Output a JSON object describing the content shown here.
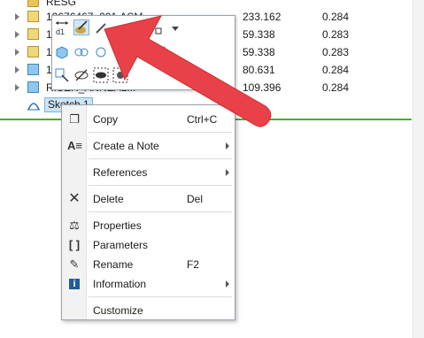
{
  "tree": {
    "top_partial": "RESG",
    "rows": [
      {
        "name": "10676467_001.ASM",
        "v1": "233.162",
        "v2": "0.284"
      },
      {
        "name": "106",
        "v1": "59.338",
        "v2": "0.283"
      },
      {
        "name": "106",
        "v1": "59.338",
        "v2": "0.283"
      },
      {
        "name": "188",
        "v1": "80.631",
        "v2": "0.284"
      },
      {
        "name": "RISER_ANNEAL...",
        "v1": "109.396",
        "v2": "0.284"
      }
    ],
    "selected_item": "Sketch 1"
  },
  "context_menu": {
    "items": {
      "copy": {
        "label": "Copy",
        "shortcut": "Ctrl+C"
      },
      "create_note": {
        "label": "Create a Note"
      },
      "references": {
        "label": "References"
      },
      "delete": {
        "label": "Delete",
        "shortcut": "Del"
      },
      "properties": {
        "label": "Properties"
      },
      "parameters": {
        "label": "Parameters"
      },
      "rename": {
        "label": "Rename",
        "shortcut": "F2"
      },
      "information": {
        "label": "Information"
      },
      "customize": {
        "label": "Customize"
      }
    }
  },
  "colors": {
    "accent_green": "#43b02a",
    "arrow_red": "#e8414a",
    "selection": "#cce4f7"
  },
  "icons": [
    "dimension-icon",
    "appearance-brush-icon",
    "pencil-icon",
    "display-style-icon",
    "component-icon",
    "dropdown-icon",
    "copy-icon",
    "note-icon",
    "delete-icon",
    "properties-icon",
    "parameters-icon",
    "rename-icon",
    "information-icon"
  ]
}
